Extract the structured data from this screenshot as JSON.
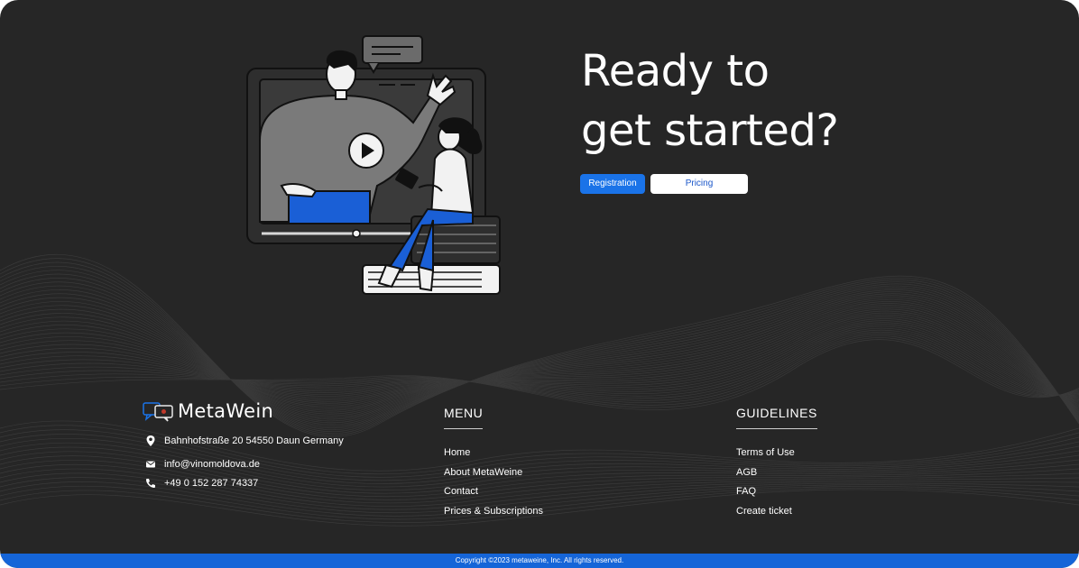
{
  "hero": {
    "title_line1": "Ready to",
    "title_line2": "get started?",
    "registration_label": "Registration",
    "pricing_label": "Pricing"
  },
  "brand": {
    "name": "MetaWein"
  },
  "contact": {
    "address": "Bahnhofstraße 20 54550 Daun Germany",
    "email": "info@vinomoldova.de",
    "phone": "+49 0 152 287 74337"
  },
  "menu": {
    "title": "MENU",
    "items": [
      "Home",
      "About MetaWeine",
      "Contact",
      "Prices & Subscriptions"
    ]
  },
  "guidelines": {
    "title": "GUIDELINES",
    "items": [
      "Terms of Use",
      "AGB",
      "FAQ",
      "Create ticket"
    ]
  },
  "footer": {
    "copyright": "Copyright ©2023 metaweine, Inc. All rights reserved."
  },
  "icons": [
    "map-pin-icon",
    "mail-icon",
    "phone-icon",
    "chat-bubbles-logo-icon",
    "play-icon"
  ],
  "colors": {
    "background": "#262626",
    "accent": "#1a73e8",
    "footer": "#1565d8"
  }
}
